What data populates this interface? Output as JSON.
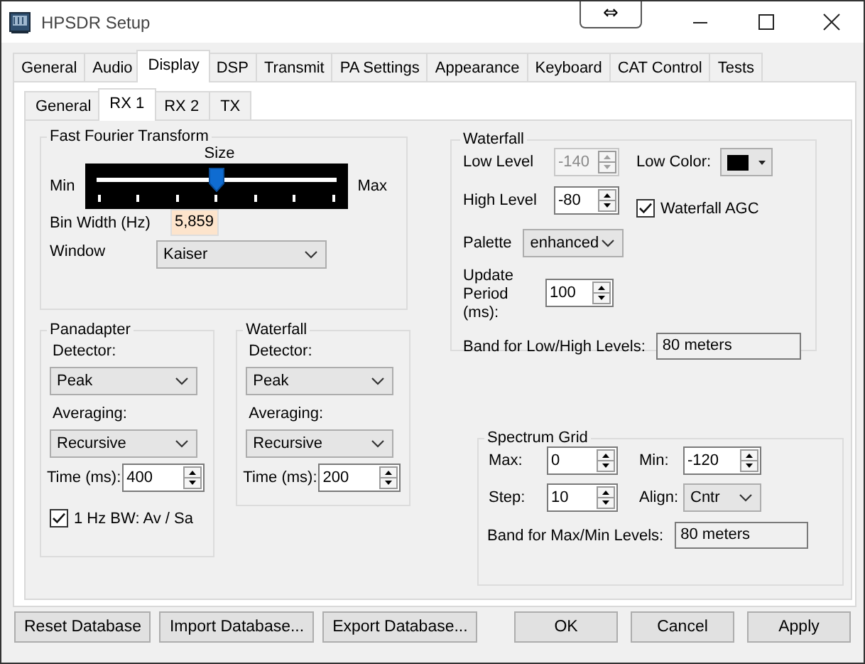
{
  "window": {
    "title": "HPSDR Setup"
  },
  "snap_button": {
    "label": "⇔"
  },
  "tabs": [
    {
      "label": "General",
      "selected": false
    },
    {
      "label": "Audio",
      "selected": false
    },
    {
      "label": "Display",
      "selected": true
    },
    {
      "label": "DSP",
      "selected": false
    },
    {
      "label": "Transmit",
      "selected": false
    },
    {
      "label": "PA Settings",
      "selected": false
    },
    {
      "label": "Appearance",
      "selected": false
    },
    {
      "label": "Keyboard",
      "selected": false
    },
    {
      "label": "CAT Control",
      "selected": false
    },
    {
      "label": "Tests",
      "selected": false
    }
  ],
  "subtabs": [
    {
      "label": "General",
      "selected": false
    },
    {
      "label": "RX 1",
      "selected": true
    },
    {
      "label": "RX 2",
      "selected": false
    },
    {
      "label": "TX",
      "selected": false
    }
  ],
  "fft": {
    "title": "Fast Fourier Transform",
    "slider": {
      "label": "Size",
      "min_label": "Min",
      "max_label": "Max",
      "level": 0.5
    },
    "bin_width": {
      "label": "Bin Width (Hz)",
      "value": "5,859"
    },
    "window": {
      "label": "Window",
      "value": "Kaiser"
    }
  },
  "panadapter": {
    "title": "Panadapter",
    "detector_label": "Detector:",
    "detector": "Peak",
    "averaging_label": "Averaging:",
    "averaging": "Recursive",
    "time_label": "Time (ms):",
    "time": "400",
    "bw_checkbox": {
      "label": "1 Hz BW: Av / Sa",
      "checked": true
    }
  },
  "waterfall_detector": {
    "title": "Waterfall",
    "detector_label": "Detector:",
    "detector": "Peak",
    "averaging_label": "Averaging:",
    "averaging": "Recursive",
    "time_label": "Time (ms):",
    "time": "200"
  },
  "waterfall": {
    "title": "Waterfall",
    "low_level": {
      "label": "Low Level",
      "value": "-140",
      "disabled": true
    },
    "high_level": {
      "label": "High Level",
      "value": "-80",
      "disabled": false
    },
    "low_color": {
      "label": "Low Color:",
      "color": "#000000"
    },
    "agc": {
      "label": "Waterfall AGC",
      "checked": true
    },
    "palette": {
      "label": "Palette",
      "value": "enhanced"
    },
    "update_period": {
      "label": "Update Period (ms):",
      "value": "100"
    },
    "band": {
      "label": "Band for Low/High Levels:",
      "value": "80 meters"
    }
  },
  "spectrum_grid": {
    "title": "Spectrum Grid",
    "max": {
      "label": "Max:",
      "value": "0"
    },
    "min": {
      "label": "Min:",
      "value": "-120"
    },
    "step": {
      "label": "Step:",
      "value": "10"
    },
    "align": {
      "label": "Align:",
      "value": "Cntr"
    },
    "band": {
      "label": "Band for Max/Min Levels:",
      "value": "80 meters"
    }
  },
  "buttons_left": [
    "Reset Database",
    "Import Database...",
    "Export Database..."
  ],
  "buttons_right": [
    "OK",
    "Cancel",
    "Apply"
  ]
}
